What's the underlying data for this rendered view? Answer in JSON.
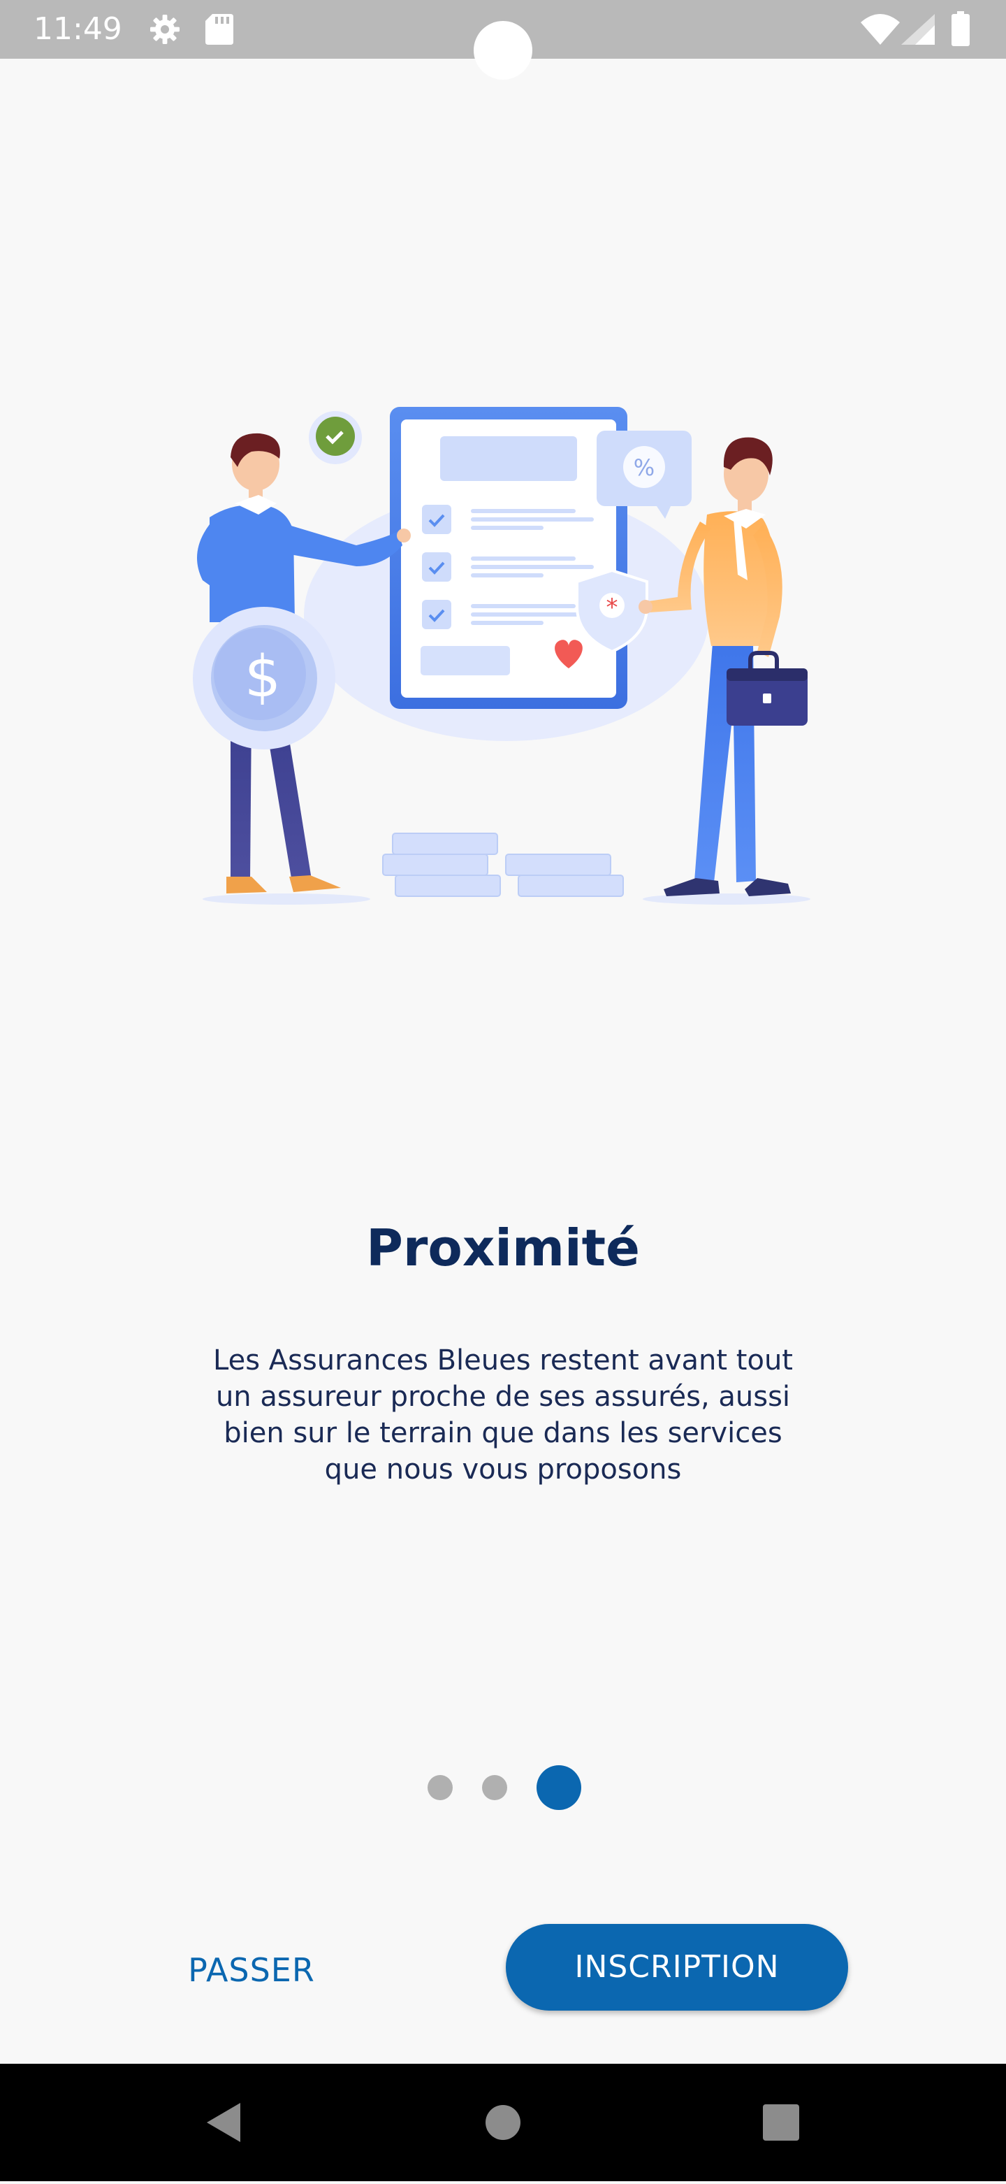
{
  "status_bar": {
    "time": "11:49"
  },
  "onboarding": {
    "title": "Proximité",
    "description_lines": [
      "Les Assurances Bleues restent avant tout",
      "un assureur proche de ses assurés, aussi",
      "bien sur le terrain que dans les services",
      "que nous vous proposons"
    ],
    "page_indicator": {
      "count": 3,
      "current_index": 2
    },
    "skip_label": "PASSER",
    "signup_label": "INSCRIPTION"
  },
  "colors": {
    "primary": "#0b67b0",
    "title_text": "#0e2a5b",
    "dot_inactive": "#b0b0b0",
    "dot_active": "#0b67b0",
    "status_bar": "#b9b9b9",
    "nav_bar": "#000000"
  },
  "icons": {
    "status": [
      "gear-icon",
      "sd-card-icon",
      "wifi-icon",
      "cellular-signal-icon",
      "battery-icon"
    ],
    "navigation": [
      "back-triangle-icon",
      "home-circle-icon",
      "recents-square-icon"
    ]
  }
}
